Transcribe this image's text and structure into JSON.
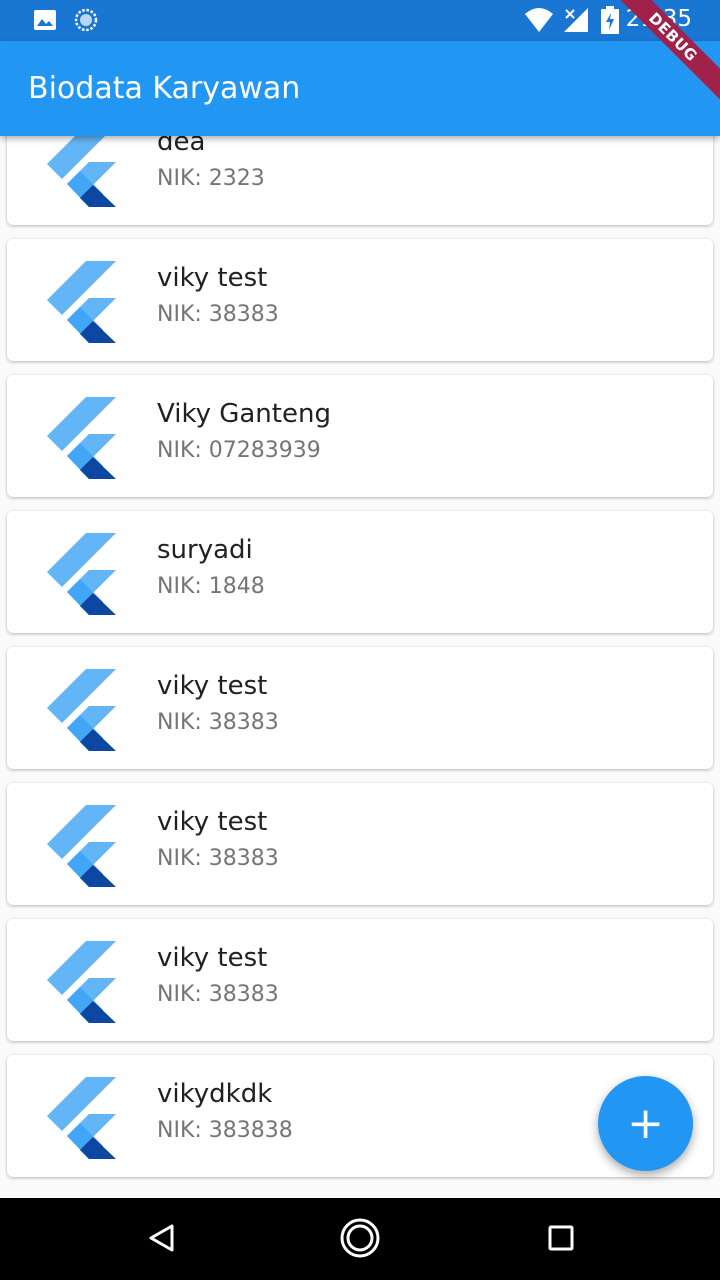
{
  "status_bar": {
    "time": "21:35",
    "icons": [
      "image-icon",
      "sync-icon",
      "wifi-icon",
      "signal-icon",
      "battery-charging-icon"
    ]
  },
  "app_bar": {
    "title": "Biodata Karyawan",
    "debug_banner": "DEBUG"
  },
  "employees": [
    {
      "name": "dea",
      "nik": "NIK: 2323"
    },
    {
      "name": "viky test",
      "nik": "NIK: 38383"
    },
    {
      "name": "Viky Ganteng",
      "nik": "NIK: 07283939"
    },
    {
      "name": "suryadi",
      "nik": "NIK: 1848"
    },
    {
      "name": "viky test",
      "nik": "NIK: 38383"
    },
    {
      "name": "viky test",
      "nik": "NIK: 38383"
    },
    {
      "name": "viky test",
      "nik": "NIK: 38383"
    },
    {
      "name": "vikydkdk",
      "nik": "NIK: 383838"
    }
  ],
  "fab": {
    "icon": "add-icon",
    "label": "+"
  },
  "nav_bar": {
    "icons": [
      "back-icon",
      "home-icon",
      "recents-icon"
    ]
  },
  "colors": {
    "status_bar": "#1976D2",
    "app_bar": "#2196F3",
    "accent": "#2196F3",
    "debug_banner": "#A0224A"
  }
}
